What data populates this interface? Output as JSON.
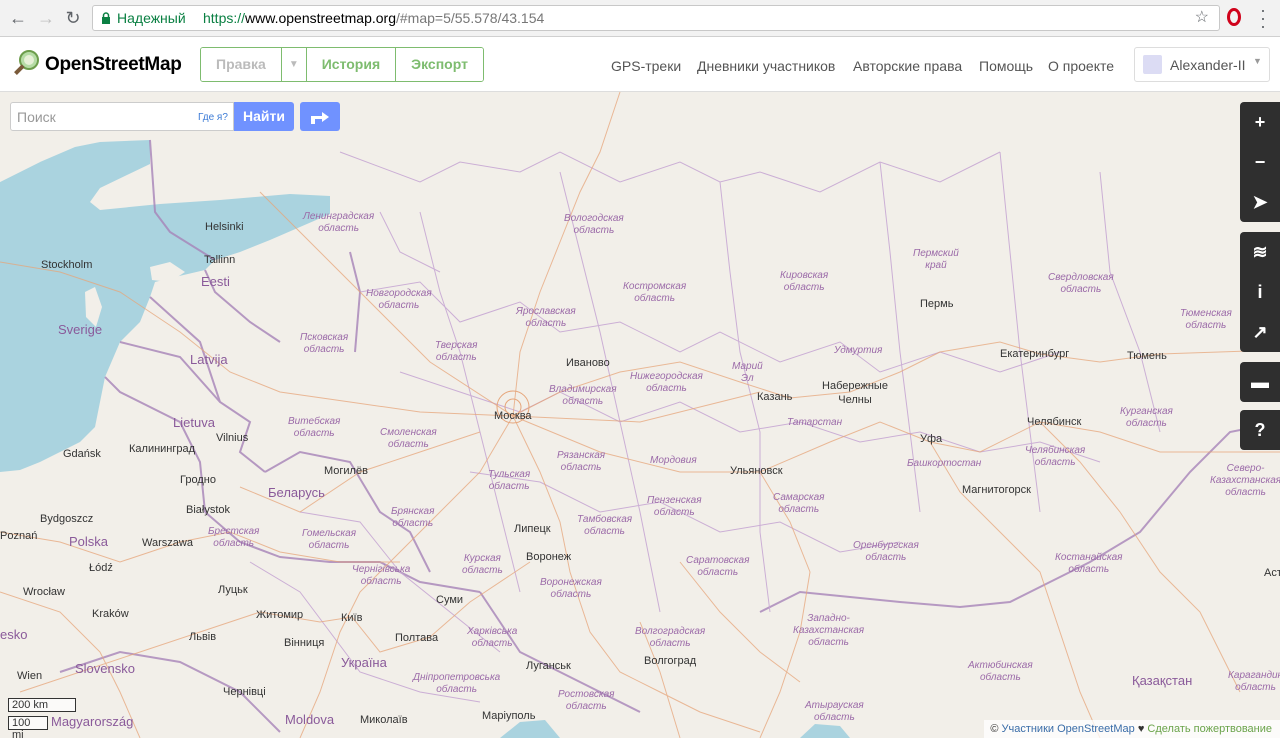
{
  "browser": {
    "secure_label": "Надежный",
    "url_proto": "https://",
    "url_host": "www.openstreetmap.org",
    "url_path": "/#map=5/55.578/43.154"
  },
  "header": {
    "logo_text": "OpenStreetMap",
    "edit_label": "Правка",
    "history_label": "История",
    "export_label": "Экспорт",
    "nav": [
      "GPS-треки",
      "Дневники участников",
      "Авторские права",
      "Помощь",
      "О проекте"
    ],
    "user_name": "Alexander-II"
  },
  "search": {
    "placeholder": "Поиск",
    "where_am_i": "Где я?",
    "go_label": "Найти"
  },
  "map": {
    "cities": [
      "Stockholm",
      "Helsinki",
      "Tallinn",
      "Gdańsk",
      "Калининград",
      "Vilnius",
      "Гродно",
      "Białystok",
      "Bydgoszcz",
      "Poznań",
      "Warszawa",
      "Łódź",
      "Wrocław",
      "Kraków",
      "Wien",
      "Луцьк",
      "Львів",
      "Житомир",
      "Київ",
      "Вінниця",
      "Чернівці",
      "Миколаїв",
      "Маріуполь",
      "Могилёв",
      "Москва",
      "Иваново",
      "Липецк",
      "Воронеж",
      "Суми",
      "Полтава",
      "Луганськ",
      "Волгоград",
      "Ульяновск",
      "Казань",
      "Набережные Челны",
      "Пермь",
      "Екатеринбург",
      "Тюмень",
      "Уфа",
      "Челябинск",
      "Магнитогорск"
    ],
    "countries": [
      "Eesti",
      "Sverige",
      "Latvija",
      "Lietuva",
      "Беларусь",
      "Polska",
      "Slovensko",
      "Україна",
      "Moldova",
      "Magyarország",
      "Қазақстан"
    ],
    "regions": [
      "Ленинградская\nобласть",
      "Вологодская\nобласть",
      "Новгородская\nобласть",
      "Костромская\nобласть",
      "Кировская\nобласть",
      "Пермский\nкрай",
      "Свердловская\nобласть",
      "Ярославская\nобласть",
      "Псковская\nобласть",
      "Тверская\nобласть",
      "Удмуртия",
      "Тюменская\nобласть",
      "Владимирская\nобласть",
      "Нижегородская\nобласть",
      "Марий\nЭл",
      "Витебская\nобласть",
      "Смоленская\nобласть",
      "Татарстан",
      "Курганская\nобласть",
      "Рязанская\nобласть",
      "Тульская\nобласть",
      "Мордовия",
      "Башкортостан",
      "Челябинская\nобласть",
      "Северо-\nКазахстанская\nобласть",
      "Брянская\nобласть",
      "Пензенская\nобласть",
      "Самарская\nобласть",
      "Брестская\nобласть",
      "Гомельская\nобласть",
      "Тамбовская\nобласть",
      "Курская\nобласть",
      "Саратовская\nобласть",
      "Оренбургская\nобласть",
      "Костанайская\nобласть",
      "Чернігівська\nобласть",
      "Воронежская\nобласть",
      "Харківська\nобласть",
      "Волгоградская\nобласть",
      "Западно-\nКазахстанская\nобласть",
      "Дніпропетровська\nобласть",
      "Ростовская\nобласть",
      "Актюбинская\nобласть",
      "Атырауская\nобласть",
      "Карагандин\nобласть"
    ],
    "edge_labels": [
      "esko",
      "Аст"
    ],
    "scale_km": "200 km",
    "scale_mi": "100 mi"
  },
  "attribution": {
    "copy": "©",
    "contributors": "Участники OpenStreetMap",
    "heart": "♥",
    "donate": "Сделать пожертвование"
  }
}
